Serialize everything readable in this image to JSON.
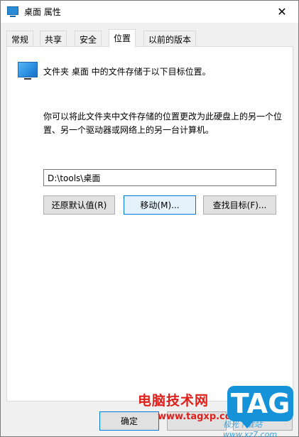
{
  "window": {
    "title": "桌面 属性",
    "close_label": "✕"
  },
  "tabs": [
    {
      "label": "常规"
    },
    {
      "label": "共享"
    },
    {
      "label": "安全"
    },
    {
      "label": "位置",
      "active": true
    },
    {
      "label": "以前的版本"
    }
  ],
  "location": {
    "info": "文件夹 桌面 中的文件存储于以下目标位置。",
    "description": "你可以将此文件夹中文件存储的位置更改为此硬盘上的另一个位置、另一个驱动器或网络上的另一台计算机。",
    "path_value": "D:\\tools\\桌面",
    "restore_label": "还原默认值(R)",
    "move_label": "移动(M)...",
    "find_label": "查找目标(F)..."
  },
  "footer": {
    "ok_label": "确定"
  },
  "watermark": {
    "site_name": "电脑技术网",
    "site_url": "www.tagxp.com",
    "tag": "TAG",
    "xz_text": "极光下载站 www.xz7.com"
  },
  "colors": {
    "accent": "#0078d7",
    "watermark_red": "#e0201b",
    "watermark_blue": "#1592d8"
  }
}
